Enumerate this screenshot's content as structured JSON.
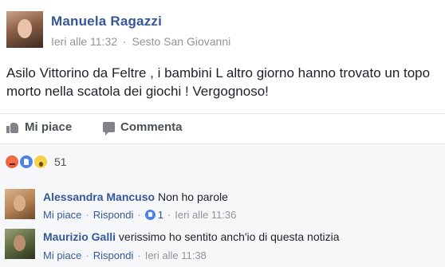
{
  "post": {
    "author": "Manuela Ragazzi",
    "time": "Ieri alle 11:32",
    "separator": "·",
    "location": "Sesto San Giovanni",
    "text": "Asilo Vittorino da Feltre , i bambini L altro giorno hanno trovato un topo morto nella scatola dei giochi ! Vergognoso!"
  },
  "actions": {
    "like_label": "Mi piace",
    "comment_label": "Commenta"
  },
  "reactions": {
    "types": [
      "angry",
      "like",
      "wow"
    ],
    "count": "51"
  },
  "comments": [
    {
      "author": "Alessandra Mancuso",
      "text": "Non ho parole",
      "like_label": "Mi piace",
      "reply_label": "Rispondi",
      "like_count": "1",
      "time": "Ieri alle 11:36"
    },
    {
      "author": "Maurizio Galli",
      "text": "verissimo ho sentito anch'io di questa notizia",
      "like_label": "Mi piace",
      "reply_label": "Rispondi",
      "time": "Ieri alle 11:38"
    }
  ],
  "colors": {
    "link": "#365899",
    "muted": "#90949c",
    "text": "#1d2129",
    "like_blue": "#4f82e6"
  }
}
